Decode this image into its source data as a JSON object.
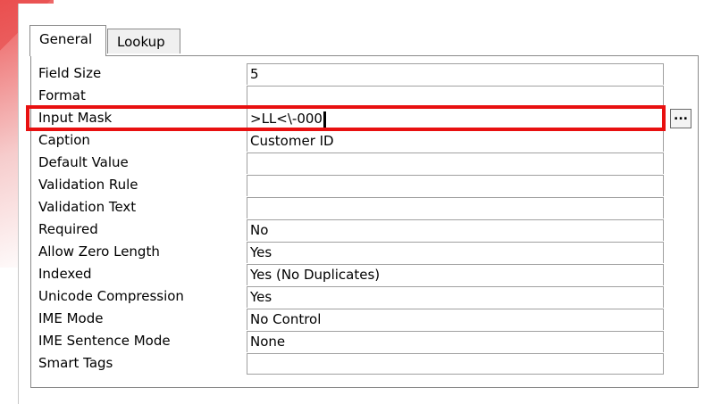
{
  "tabs": [
    {
      "label": "General",
      "active": true
    },
    {
      "label": "Lookup",
      "active": false
    }
  ],
  "properties": [
    {
      "label": "Field Size",
      "value": "5"
    },
    {
      "label": "Format",
      "value": ""
    },
    {
      "label": "Input Mask",
      "value": ">LL<\\-000"
    },
    {
      "label": "Caption",
      "value": "Customer ID"
    },
    {
      "label": "Default Value",
      "value": ""
    },
    {
      "label": "Validation Rule",
      "value": ""
    },
    {
      "label": "Validation Text",
      "value": ""
    },
    {
      "label": "Required",
      "value": "No"
    },
    {
      "label": "Allow Zero Length",
      "value": "Yes"
    },
    {
      "label": "Indexed",
      "value": "Yes (No Duplicates)"
    },
    {
      "label": "Unicode Compression",
      "value": "Yes"
    },
    {
      "label": "IME Mode",
      "value": "No Control"
    },
    {
      "label": "IME Sentence Mode",
      "value": "None"
    },
    {
      "label": "Smart Tags",
      "value": ""
    }
  ],
  "builder_button": {
    "label": "..."
  },
  "colors": {
    "highlight": "#e81010",
    "accent_stripe": "#e23a3a"
  }
}
